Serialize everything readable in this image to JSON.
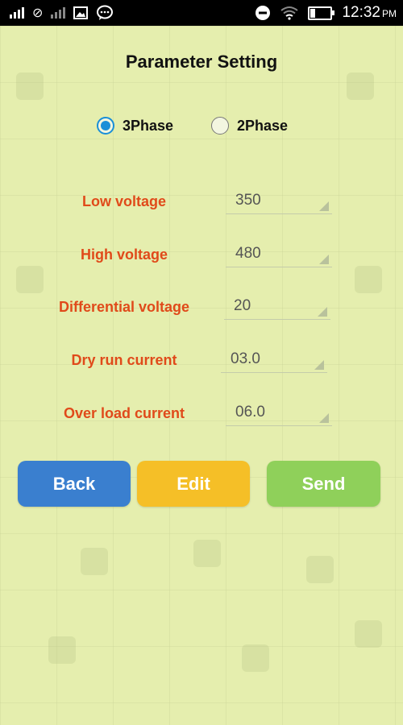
{
  "status_bar": {
    "time": "12:32",
    "ampm": "PM",
    "icons": [
      "signal-icon",
      "no-sim-icon",
      "signal-icon",
      "image-icon",
      "chat-icon",
      "do-not-disturb-icon",
      "wifi-icon",
      "battery-icon"
    ]
  },
  "page": {
    "title": "Parameter Setting"
  },
  "phase": {
    "options": [
      {
        "label": "3Phase",
        "selected": true
      },
      {
        "label": "2Phase",
        "selected": false
      }
    ]
  },
  "parameters": [
    {
      "label": "Low voltage",
      "value": "350"
    },
    {
      "label": "High voltage",
      "value": "480"
    },
    {
      "label": "Differential voltage",
      "value": "20"
    },
    {
      "label": "Dry run current",
      "value": "03.0"
    },
    {
      "label": "Over load current",
      "value": "06.0"
    }
  ],
  "buttons": {
    "back": {
      "label": "Back",
      "color": "#3a7fcf"
    },
    "edit": {
      "label": "Edit",
      "color": "#f5bf27"
    },
    "send": {
      "label": "Send",
      "color": "#8fd05a"
    }
  },
  "colors": {
    "background": "#e6efb0",
    "label": "#e04a1a",
    "radio_accent": "#1a8fd8"
  }
}
